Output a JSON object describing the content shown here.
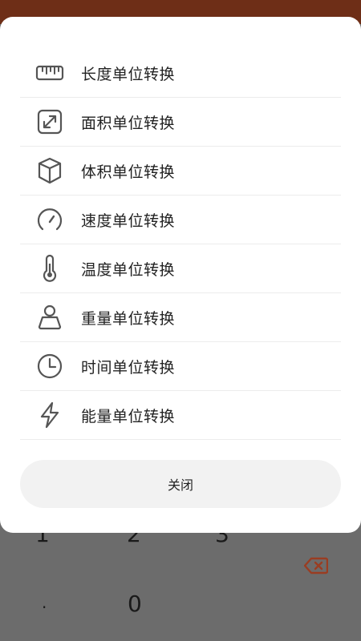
{
  "colors": {
    "topbar": "#6e2e17",
    "overlay_bg": "#6c6c6c",
    "dialog_bg": "#ffffff",
    "close_button_bg": "#f2f2f2",
    "icon_stroke": "#555555",
    "backspace_accent": "#b5472a"
  },
  "dialog": {
    "items": [
      {
        "label": "长度单位转换",
        "icon": "ruler-icon"
      },
      {
        "label": "面积单位转换",
        "icon": "area-expand-icon"
      },
      {
        "label": "体积单位转换",
        "icon": "cube-icon"
      },
      {
        "label": "速度单位转换",
        "icon": "speedometer-icon"
      },
      {
        "label": "温度单位转换",
        "icon": "thermometer-icon"
      },
      {
        "label": "重量单位转换",
        "icon": "weight-icon"
      },
      {
        "label": "时间单位转换",
        "icon": "clock-icon"
      },
      {
        "label": "能量单位转换",
        "icon": "lightning-icon"
      }
    ],
    "close_label": "关闭"
  },
  "background_keypad": {
    "keys": [
      "1",
      "2",
      "3",
      ".",
      "0"
    ],
    "backspace_icon": "backspace-icon"
  }
}
